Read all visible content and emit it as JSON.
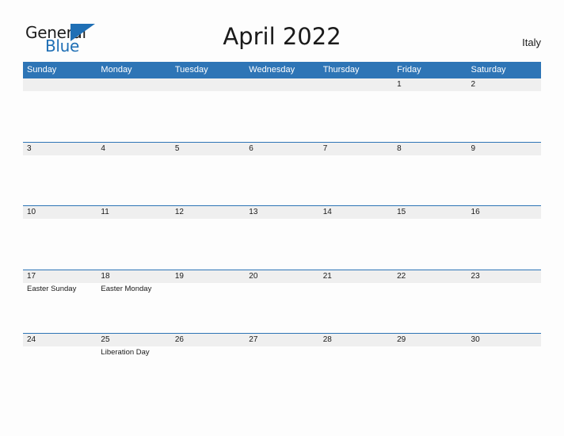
{
  "brand": {
    "name_part1": "General",
    "name_part2": "Blue",
    "triangle_color": "#1f6fb5"
  },
  "header": {
    "title": "April 2022",
    "country": "Italy"
  },
  "theme": {
    "header_blue": "#2e75b6",
    "date_band": "#efefef",
    "page_background": "#fdfdfd",
    "text": "#1a1a1a"
  },
  "calendar": {
    "month": "April",
    "year": "2022",
    "weekday_headers": [
      "Sunday",
      "Monday",
      "Tuesday",
      "Wednesday",
      "Thursday",
      "Friday",
      "Saturday"
    ],
    "weeks": [
      [
        {
          "date": "",
          "event": ""
        },
        {
          "date": "",
          "event": ""
        },
        {
          "date": "",
          "event": ""
        },
        {
          "date": "",
          "event": ""
        },
        {
          "date": "",
          "event": ""
        },
        {
          "date": "1",
          "event": ""
        },
        {
          "date": "2",
          "event": ""
        }
      ],
      [
        {
          "date": "3",
          "event": ""
        },
        {
          "date": "4",
          "event": ""
        },
        {
          "date": "5",
          "event": ""
        },
        {
          "date": "6",
          "event": ""
        },
        {
          "date": "7",
          "event": ""
        },
        {
          "date": "8",
          "event": ""
        },
        {
          "date": "9",
          "event": ""
        }
      ],
      [
        {
          "date": "10",
          "event": ""
        },
        {
          "date": "11",
          "event": ""
        },
        {
          "date": "12",
          "event": ""
        },
        {
          "date": "13",
          "event": ""
        },
        {
          "date": "14",
          "event": ""
        },
        {
          "date": "15",
          "event": ""
        },
        {
          "date": "16",
          "event": ""
        }
      ],
      [
        {
          "date": "17",
          "event": "Easter Sunday"
        },
        {
          "date": "18",
          "event": "Easter Monday"
        },
        {
          "date": "19",
          "event": ""
        },
        {
          "date": "20",
          "event": ""
        },
        {
          "date": "21",
          "event": ""
        },
        {
          "date": "22",
          "event": ""
        },
        {
          "date": "23",
          "event": ""
        }
      ],
      [
        {
          "date": "24",
          "event": ""
        },
        {
          "date": "25",
          "event": "Liberation Day"
        },
        {
          "date": "26",
          "event": ""
        },
        {
          "date": "27",
          "event": ""
        },
        {
          "date": "28",
          "event": ""
        },
        {
          "date": "29",
          "event": ""
        },
        {
          "date": "30",
          "event": ""
        }
      ]
    ]
  }
}
